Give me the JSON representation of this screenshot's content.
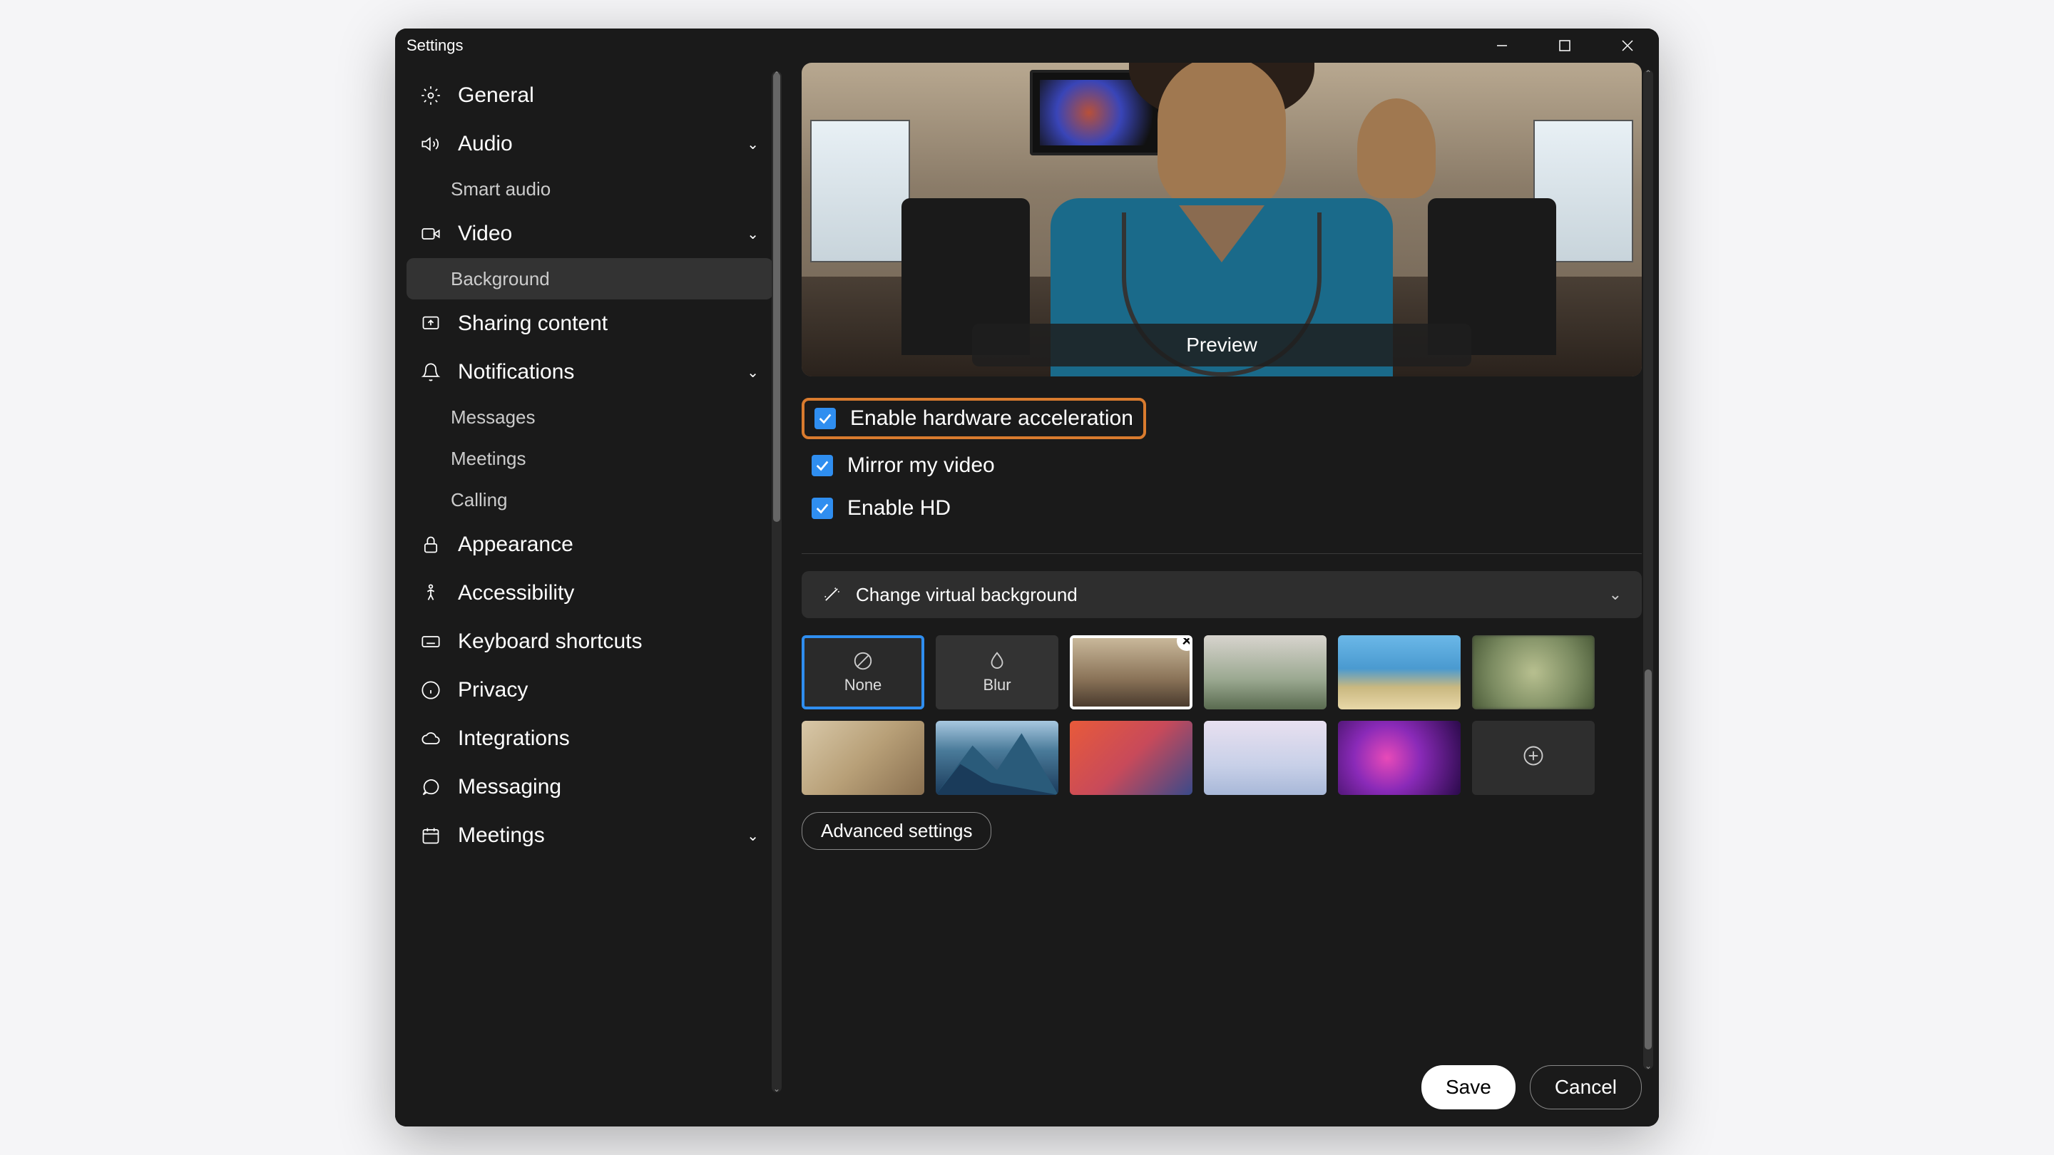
{
  "window": {
    "title": "Settings"
  },
  "sidebar": {
    "items": [
      {
        "label": "General"
      },
      {
        "label": "Audio"
      },
      {
        "label": "Smart audio"
      },
      {
        "label": "Video"
      },
      {
        "label": "Background"
      },
      {
        "label": "Sharing content"
      },
      {
        "label": "Notifications"
      },
      {
        "label": "Messages"
      },
      {
        "label": "Meetings"
      },
      {
        "label": "Calling"
      },
      {
        "label": "Appearance"
      },
      {
        "label": "Accessibility"
      },
      {
        "label": "Keyboard shortcuts"
      },
      {
        "label": "Privacy"
      },
      {
        "label": "Integrations"
      },
      {
        "label": "Messaging"
      },
      {
        "label": "Meetings"
      }
    ]
  },
  "main": {
    "preview_button": "Preview",
    "checks": [
      {
        "label": "Enable hardware acceleration",
        "checked": true,
        "highlight": true
      },
      {
        "label": "Mirror my video",
        "checked": true
      },
      {
        "label": "Enable HD",
        "checked": true
      }
    ],
    "section_header": "Change virtual background",
    "backgrounds": {
      "none_label": "None",
      "blur_label": "Blur"
    },
    "advanced_button": "Advanced settings",
    "save_button": "Save",
    "cancel_button": "Cancel"
  }
}
